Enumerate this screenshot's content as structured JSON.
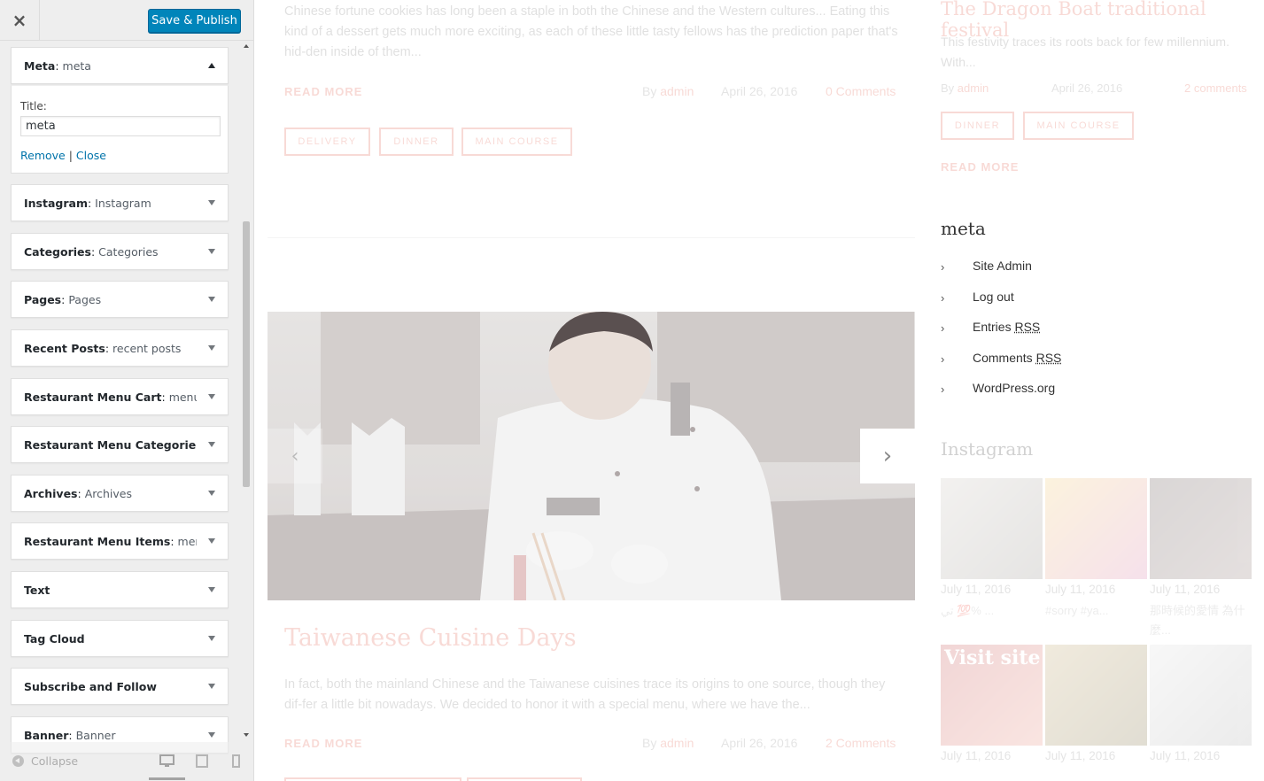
{
  "header": {
    "close_label": "×",
    "save_label": "Save & Publish"
  },
  "widgets": [
    {
      "name": "Meta",
      "sub": "meta",
      "open": true
    },
    {
      "name": "Instagram",
      "sub": "Instagram"
    },
    {
      "name": "Categories",
      "sub": "Categories"
    },
    {
      "name": "Pages",
      "sub": "Pages"
    },
    {
      "name": "Recent Posts",
      "sub": "recent posts"
    },
    {
      "name": "Restaurant Menu Cart",
      "sub": "menu ..."
    },
    {
      "name": "Restaurant Menu Categories",
      "sub": "..."
    },
    {
      "name": "Archives",
      "sub": "Archives"
    },
    {
      "name": "Restaurant Menu Items",
      "sub": "men..."
    },
    {
      "name": "Text",
      "sub": ""
    },
    {
      "name": "Tag Cloud",
      "sub": ""
    },
    {
      "name": "Subscribe and Follow",
      "sub": ""
    },
    {
      "name": "Banner",
      "sub": "Banner"
    }
  ],
  "meta_form": {
    "title_label": "Title:",
    "title_value": "meta",
    "remove_label": "Remove",
    "separator": "|",
    "close_label": "Close"
  },
  "footer": {
    "collapse_label": "Collapse"
  },
  "preview": {
    "post1": {
      "excerpt": "Chinese fortune cookies has long been a staple in both the Chinese and the Western cultures... Eating this kind of a dessert gets much more exciting, as each of these little tasty fellows has the prediction paper that's hid-den inside of them...",
      "read_more": "READ MORE",
      "by": "By",
      "author": "admin",
      "date": "April 26, 2016",
      "comments": "0 Comments",
      "tags": [
        "DELIVERY",
        "DINNER",
        "MAIN COURSE"
      ]
    },
    "post2": {
      "title": "Taiwanese Cuisine Days",
      "excerpt": "In fact, both the mainland Chinese and the Taiwanese cuisines trace its origins to one source, though they dif-fer a little bit nowadays. We decided to honor it with a special menu, where we have the...",
      "read_more": "READ MORE",
      "by": "By",
      "author": "admin",
      "date": "April 26, 2016",
      "comments": "2 Comments"
    },
    "side_post": {
      "title": "The Dragon Boat traditional festival",
      "excerpt": "This festivity traces its roots back for few millennium. With...",
      "by": "By",
      "author": "admin",
      "date": "April 26, 2016",
      "comments": "2 comments",
      "tags": [
        "DINNER",
        "MAIN COURSE"
      ],
      "read_more": "READ MORE"
    },
    "meta_widget": {
      "title": "meta",
      "items": [
        {
          "text": "Site Admin"
        },
        {
          "text": "Log out"
        },
        {
          "text": "Entries ",
          "abbr": "RSS"
        },
        {
          "text": "Comments ",
          "abbr": "RSS"
        },
        {
          "text": "WordPress.org"
        }
      ]
    },
    "instagram": {
      "title": "Instagram",
      "posts": [
        {
          "date": "July 11, 2016",
          "caption": "ت⁠ي 💯% ...",
          "colors": [
            "#c9c3bb",
            "#8f8a84"
          ]
        },
        {
          "date": "July 11, 2016",
          "caption": "#sorry #ya...",
          "colors": [
            "#f2c86a",
            "#d97aa8"
          ]
        },
        {
          "date": "July 11, 2016",
          "caption": "那時候的愛情 為什麼...",
          "colors": [
            "#5a4a48",
            "#8a7470"
          ]
        },
        {
          "date": "July 11, 2016",
          "caption": "",
          "colors": [
            "#c24848",
            "#e98b7a"
          ],
          "overlay": "Visit site"
        },
        {
          "date": "July 11, 2016",
          "caption": "",
          "colors": [
            "#bfa468",
            "#7a6a3a"
          ]
        },
        {
          "date": "July 11, 2016",
          "caption": "",
          "colors": [
            "#e0e0e0",
            "#a8a8a8"
          ]
        }
      ]
    }
  }
}
